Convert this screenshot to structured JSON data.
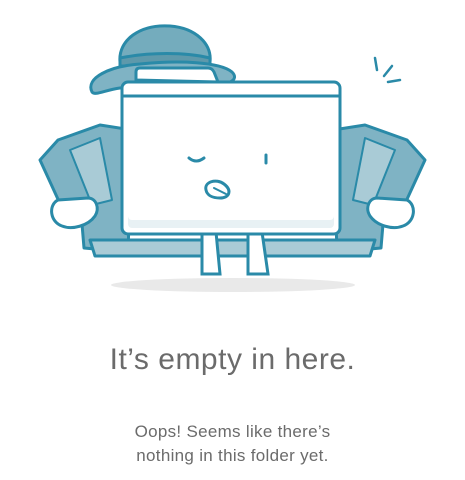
{
  "empty_state": {
    "title": "It’s empty in here.",
    "message_line_1": "Oops! Seems like there’s",
    "message_line_2": "nothing in this folder yet."
  },
  "illustration": {
    "icon": "folder-detective-icon",
    "colors": {
      "outline": "#2a8aa8",
      "coat": "#7fb3c4",
      "coat_light": "#a9cbd6",
      "hat": "#74acbd",
      "folder_fill": "#ffffff",
      "folder_shade": "#e8f1f4",
      "shadow": "#e6e6e6"
    }
  }
}
